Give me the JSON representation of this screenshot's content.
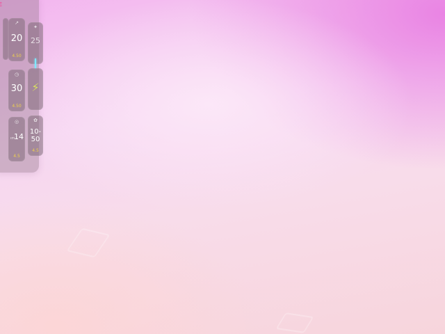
{
  "panel": {
    "title": "E",
    "tiles": [
      {
        "icon": "",
        "value": "",
        "footer": ""
      },
      {
        "icon": "↗",
        "value": "20",
        "footer": "4.50"
      },
      {
        "icon": "✦",
        "value": "25",
        "footer": ""
      },
      {
        "icon": "◷",
        "value": "30",
        "footer": "4.50"
      },
      {
        "icon": "⚡",
        "value": "⚡",
        "footer": ""
      },
      {
        "icon": "◎",
        "prefix": "ım",
        "value": "14",
        "footer": "4.5"
      },
      {
        "icon": "✿",
        "value": "10-50",
        "footer": "4.5"
      }
    ]
  },
  "colors": {
    "accent_title": "#ff2f8a",
    "value_text": "#ffffff",
    "footer_text": "#f1d24a",
    "bolt": "#d8e060",
    "cursor": "#7fe8ff"
  }
}
